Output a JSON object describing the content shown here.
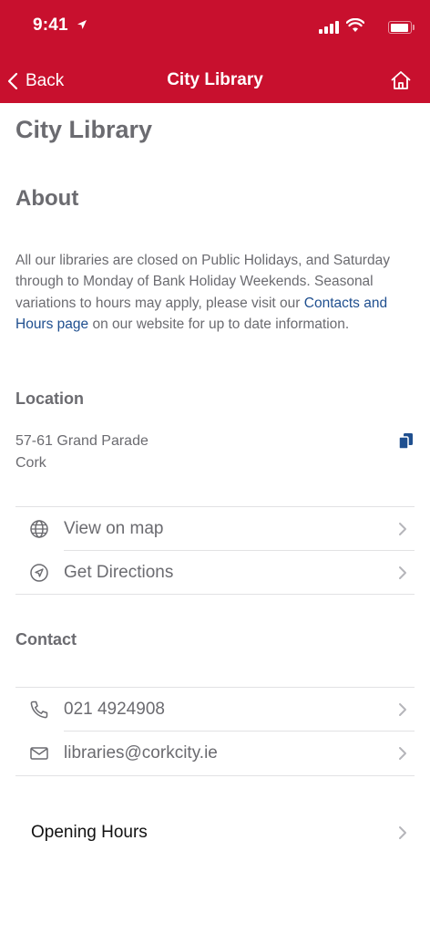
{
  "status_bar": {
    "time": "9:41"
  },
  "nav": {
    "back_label": "Back",
    "title": "City Library"
  },
  "page": {
    "title": "City Library",
    "about_heading": "About",
    "about_text_before": "All our libraries are closed on Public Holidays, and Saturday through to Monday of Bank Holiday Weekends. Seasonal variations to hours may apply, please visit our ",
    "about_link": "Contacts and Hours page",
    "about_text_after": " on our website for up to date information."
  },
  "location": {
    "heading": "Location",
    "address_line1": "57-61 Grand Parade",
    "address_line2": "Cork",
    "actions": [
      {
        "label": "View on map",
        "icon": "globe-icon"
      },
      {
        "label": "Get Directions",
        "icon": "navigation-icon"
      }
    ]
  },
  "contact": {
    "heading": "Contact",
    "items": [
      {
        "label": "021 4924908",
        "icon": "phone-icon"
      },
      {
        "label": "libraries@corkcity.ie",
        "icon": "mail-icon"
      }
    ]
  },
  "opening_hours": {
    "label": "Opening Hours"
  },
  "colors": {
    "brand_red": "#c8102e",
    "link_blue": "#1f4f8f",
    "text_gray": "#6b6b70"
  }
}
